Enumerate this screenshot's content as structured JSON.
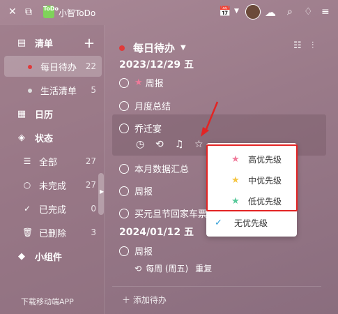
{
  "app": {
    "title": "小智ToDo",
    "logo_text": "ToDo"
  },
  "sidebar": {
    "lists_header": "清单",
    "lists": [
      {
        "label": "每日待办",
        "count": "22"
      },
      {
        "label": "生活清单",
        "count": "5"
      }
    ],
    "calendar": "日历",
    "status_header": "状态",
    "status_items": [
      {
        "label": "全部",
        "count": "27"
      },
      {
        "label": "未完成",
        "count": "27"
      },
      {
        "label": "已完成",
        "count": "0"
      },
      {
        "label": "已删除",
        "count": "3"
      }
    ],
    "widgets": "小组件",
    "download": "下载移动端APP"
  },
  "main": {
    "list_title": "每日待办",
    "groups": [
      {
        "date": "2023/12/29 五"
      },
      {
        "date": "2024/01/12 五"
      }
    ],
    "tasks": [
      {
        "title": "周报"
      },
      {
        "title": "月度总结"
      },
      {
        "title": "乔迁宴"
      },
      {
        "title": "本月数据汇总"
      },
      {
        "title": "周报"
      },
      {
        "title": "买元旦节回家车票"
      },
      {
        "title": "周报",
        "repeat": "每周 (周五)",
        "repeat_label": "重复"
      }
    ],
    "add_task": "添加待办"
  },
  "priority_menu": {
    "items": [
      {
        "label": "高优先级",
        "color": "#f07a9a"
      },
      {
        "label": "中优先级",
        "color": "#f5c542"
      },
      {
        "label": "低优先级",
        "color": "#57c99a"
      },
      {
        "label": "无优先级"
      }
    ]
  },
  "colors": {
    "accent": "#e03a3a",
    "highlight": "#e32424"
  }
}
